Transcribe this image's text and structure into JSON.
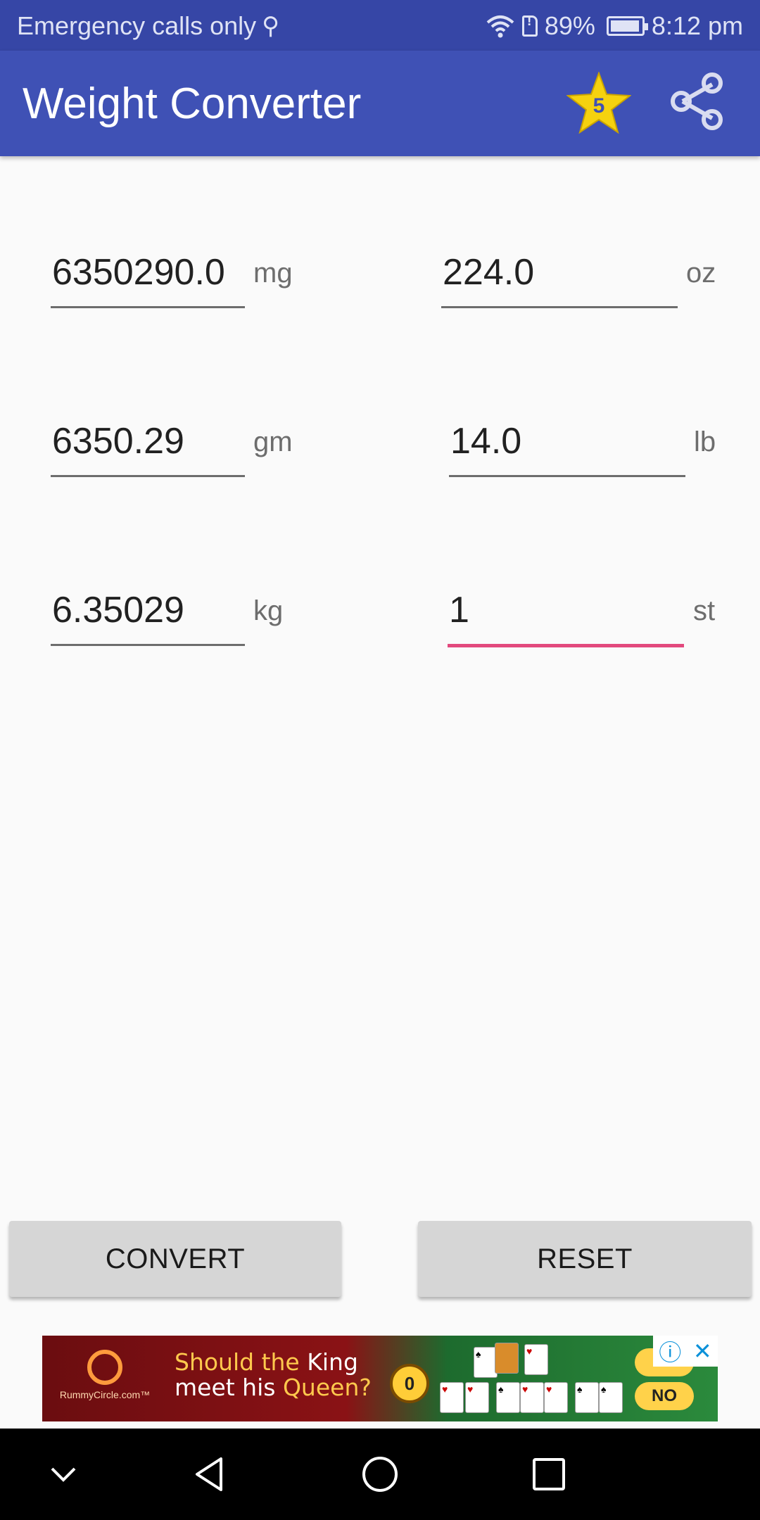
{
  "status_bar": {
    "carrier_text": "Emergency calls only",
    "battery_percent": "89%",
    "time": "8:12 pm",
    "icons": [
      "usb-icon",
      "wifi-icon",
      "sim-alert-icon",
      "battery-charging-icon"
    ]
  },
  "app_bar": {
    "title": "Weight Converter",
    "rating_badge": "5",
    "icons": [
      "star-rate-icon",
      "share-icon"
    ]
  },
  "fields": {
    "mg": {
      "value": "6350290.0",
      "unit": "mg"
    },
    "gm": {
      "value": "6350.29",
      "unit": "gm"
    },
    "kg": {
      "value": "6.35029",
      "unit": "kg"
    },
    "oz": {
      "value": "224.0",
      "unit": "oz"
    },
    "lb": {
      "value": "14.0",
      "unit": "lb"
    },
    "st": {
      "value": "1",
      "unit": "st",
      "focused": true
    }
  },
  "buttons": {
    "convert": "CONVERT",
    "reset": "RESET"
  },
  "ad": {
    "brand": "RummyCircle.com™",
    "line1_a": "Should the ",
    "line1_b": "King",
    "line2_a": "meet his ",
    "line2_b": "Queen?",
    "chip": "0",
    "no_label": "NO",
    "info_icon": "ⓘ",
    "close_icon": "✕"
  },
  "nav_bar": {
    "icons": [
      "collapse-chevron-icon",
      "back-icon",
      "home-icon",
      "recents-icon"
    ]
  },
  "colors": {
    "status_bar": "#3646a6",
    "app_bar": "#3f51b5",
    "accent_underline": "#e2497d",
    "background": "#fafafa",
    "button": "#d6d6d6"
  }
}
